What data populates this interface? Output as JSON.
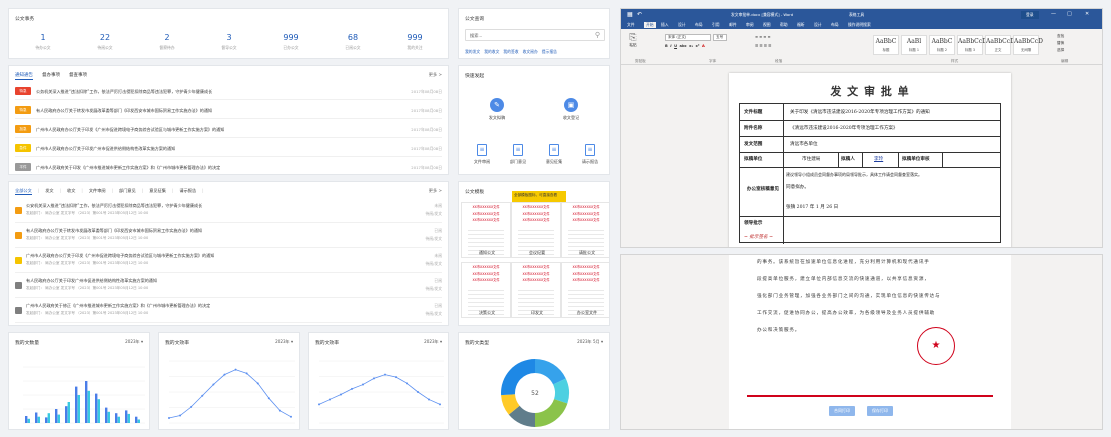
{
  "summary": {
    "title": "公文事务",
    "stats": [
      {
        "n": "1",
        "l": "待办公文"
      },
      {
        "n": "22",
        "l": "待阅公文"
      },
      {
        "n": "2",
        "l": "督察待办"
      },
      {
        "n": "3",
        "l": "督导公文"
      },
      {
        "n": "999",
        "l": "已办公文"
      },
      {
        "n": "68",
        "l": "已阅公文"
      },
      {
        "n": "999",
        "l": "我的关注"
      }
    ]
  },
  "search": {
    "title": "公文查询",
    "placeholder": "搜索...",
    "links": [
      "我的发文",
      "我的收文",
      "我的签收",
      "收文阅办",
      "提示报告"
    ]
  },
  "notices": {
    "tabs": [
      "通知通告",
      "督办事项",
      "督查事项"
    ],
    "more": "更多 >",
    "rows": [
      {
        "badge": "特急",
        "color": "#e8432e",
        "text": "公务机关深入推进“违法扣除”工作，依法严厉打击侵犯扣除商品等违法犯罪，守护青少年健康成长",
        "date": "2017年08月08日"
      },
      {
        "badge": "特急",
        "color": "#f39c12",
        "text": "有人民政府办公厅关于转发市发展改革委等部门《印发西安市城市国际贸易工作实施办法》的通知",
        "date": "2017年08月08日"
      },
      {
        "badge": "加急",
        "color": "#f39c12",
        "text": "广州市人民政府办公厅关于印发《广州市促进跨境电子商务综合试验区与城市更新工作实施方案》的通知",
        "date": "2017年08月08日"
      },
      {
        "badge": "急件",
        "color": "#f5c400",
        "text": "广州市人民政府办公厅关于印发广州市促进供给侧结构性改革实施方案的通知",
        "date": "2017年08月08日"
      },
      {
        "badge": "平件",
        "color": "#999999",
        "text": "广州市人民政府关于印发《广州市推进城市更新工作实施方案》和《广州市城市更新管理办法》的决定",
        "date": "2017年08月08日"
      }
    ]
  },
  "quick": {
    "title": "快速发起",
    "big": [
      {
        "label": "发文拟稿",
        "icon": "edit-icon"
      },
      {
        "label": "收文登记",
        "icon": "inbox-icon"
      }
    ],
    "small": [
      "文件审阅",
      "部门意见",
      "意见征集",
      "请示报告"
    ]
  },
  "docs": {
    "tabs": [
      "全部公文",
      "发文",
      "收文",
      "文件审阅",
      "部门意见",
      "意见征集",
      "请示报告"
    ],
    "more": "更多 >",
    "rows": [
      {
        "color": "#f39c12",
        "text": "公安机关深入推进“违法扣除”工作，依法严厉打击侵犯扣除商品等违法犯罪，守护青少年健康成长",
        "meta": "发起部门：  局办公室    发文字号 （2023）第001号      2023年05月12日 10:00",
        "state": "未阅",
        "state2": "待阅/发文"
      },
      {
        "color": "#f39c12",
        "text": "有人民政府办公厅关于转发市发展改革委等部门《印发西安市城市国际贸易工作实施办法》的通知",
        "meta": "发起部门：  局办公室    发文字号 （2023）第001号      2023年05月12日 10:00",
        "state": "已阅",
        "state2": "待阅/发文"
      },
      {
        "color": "#f5c400",
        "text": "广州市人民政府办公厅关于印发《广州市促进跨境电子商务综合试验区与城市更新工作实施方案》的通知",
        "meta": "发起部门：  局办公室    发文字号 （2023）第001号      2023年05月12日 10:00",
        "state": "未阅",
        "state2": "待阅/发文"
      },
      {
        "color": "#7f7f7f",
        "text": "有人民政府办公厅关于印发广州市促进供给侧结构性改革实施方案的通知",
        "meta": "发起部门：  局办公室    发文字号 （2023）第001号      2023年05月12日 10:00",
        "state": "已阅",
        "state2": "待阅/发文"
      },
      {
        "color": "#7f7f7f",
        "text": "广州市人民政府关于修正《广州市推进城市更新工作实施方案》和《广州市城市更新管理办法》的决定",
        "meta": "发起部门：  局办公室    发文字号 （2023）第001号      2023年05月12日 10:00",
        "state": "已阅",
        "state2": "待阅/发文"
      }
    ]
  },
  "templates": {
    "title": "公文模板",
    "tip": "全部模板图标，可直接查看",
    "red": "XX市XXXXXX文件",
    "labels": [
      "通知公文",
      "会议纪要",
      "请批公文",
      "决策公文",
      "印发文",
      "办公室文件"
    ]
  },
  "charts": [
    {
      "title": "我的文数量",
      "year": "2023年"
    },
    {
      "title": "我的文效率",
      "year": "2023年"
    },
    {
      "title": "我的文效率",
      "year": "2023年"
    }
  ],
  "donut": {
    "title": "我的文类型",
    "year": "2023年  5月",
    "center": "52"
  },
  "chart_data": [
    {
      "type": "bar",
      "categories": [
        "1",
        "2",
        "3",
        "4",
        "5",
        "6",
        "7",
        "8",
        "9",
        "10",
        "11",
        "12"
      ],
      "series": [
        {
          "values": [
            10,
            15,
            8,
            20,
            24,
            52,
            60,
            42,
            22,
            14,
            18,
            9
          ]
        },
        {
          "values": [
            6,
            9,
            14,
            12,
            30,
            40,
            46,
            34,
            16,
            9,
            13,
            5
          ]
        }
      ],
      "ylim": [
        0,
        80
      ]
    },
    {
      "type": "line",
      "x": [
        "1",
        "2",
        "3",
        "4",
        "5",
        "6",
        "7",
        "8",
        "9",
        "10",
        "11",
        "12"
      ],
      "values": [
        8,
        12,
        26,
        44,
        62,
        78,
        86,
        80,
        64,
        40,
        20,
        10
      ],
      "ylim": [
        0,
        100
      ]
    },
    {
      "type": "line",
      "x": [
        "1",
        "2",
        "3",
        "4",
        "5",
        "6",
        "7",
        "8",
        "9",
        "10",
        "11",
        "12"
      ],
      "values": [
        30,
        38,
        46,
        55,
        62,
        72,
        78,
        74,
        64,
        50,
        38,
        30
      ],
      "ylim": [
        0,
        100
      ]
    },
    {
      "type": "pie",
      "values": [
        18,
        12,
        20,
        14,
        10,
        26
      ],
      "colors": [
        "#36a2eb",
        "#4dd0e1",
        "#8bc34a",
        "#607d8b",
        "#ffca28",
        "#1e88e5"
      ]
    }
  ],
  "word": {
    "title": "发文审批单.docx  [兼容模式]  -  Word",
    "right_tab": "表格工具",
    "signin": "登录",
    "menu": [
      "文件",
      "开始",
      "插入",
      "设计",
      "布局",
      "引用",
      "邮件",
      "审阅",
      "视图",
      "帮助",
      "福昕",
      "设计",
      "布局",
      "操作说明搜索"
    ],
    "styles": [
      {
        "s": "AaBbC",
        "n": "标题"
      },
      {
        "s": "AaBl",
        "n": "标题 1"
      },
      {
        "s": "AaBbC",
        "n": "标题 2"
      },
      {
        "s": "AaBbCcD",
        "n": "标题 3"
      },
      {
        "s": "AaBbCcD",
        "n": "正文"
      },
      {
        "s": "AaBbCcD",
        "n": "无间隔"
      }
    ],
    "ribbon": [
      "粘贴",
      "剪贴板",
      "字体",
      "段落",
      "样式",
      "编辑"
    ],
    "font": "宋体 (正文)",
    "size": "五号",
    "edit": [
      "查找",
      "替换",
      "选择"
    ],
    "form": {
      "heading": "发 文 审 批 单",
      "rows": [
        {
          "k": "文件标题",
          "v": "关于印发《清远市违法建设2016-2020年专项治理工作方案》的通知"
        },
        {
          "k": "附件名称",
          "v": "《清远市违法建设2016-2020年专项治理工作方案》"
        },
        {
          "k": "发文范围",
          "v": "清远市各单位"
        }
      ],
      "draft_unit_k": "拟稿单位",
      "draft_unit_v": "市住建局",
      "draft_person_k": "拟稿人",
      "draft_person_v": "李玲",
      "review_k": "拟稿单位审核",
      "office_k": "办公室核稿意见",
      "office_v": "建议领导小组成员会同督办事项的局领导批示，具体工作请会同督查室落实。",
      "office_v2": "同意拟办。",
      "office_sign": "张镇    2017 年 1 月 26 日",
      "leader_k": "领导批示"
    }
  },
  "page2": {
    "lines": [
      "的事务。该系统旨在加速单位信息化进程，充分利用计算机和现代通讯手",
      "段提高单位服务，建立单位内部信息交流的快速通道，以共享信息资源，",
      "强化部门业务管理，加强各业务部门之间的沟通，实现单位信息的快速传达与",
      "工作交流，促进协同办公，提高办公效率，为各级领导及业务人员提供辅助",
      "办公和决策服务。"
    ],
    "btn1": "合同打印",
    "btn2": "保存打印"
  }
}
